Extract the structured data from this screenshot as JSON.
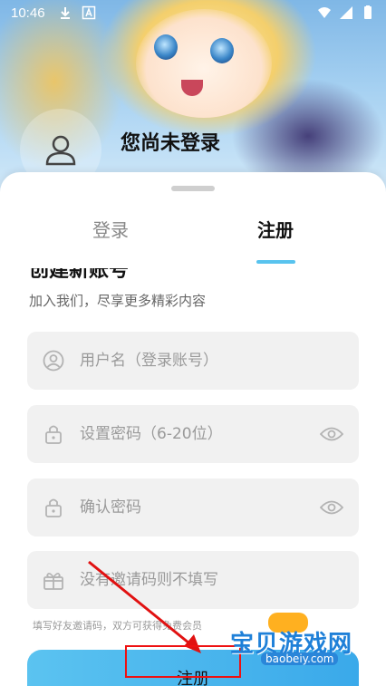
{
  "status_bar": {
    "time": "10:46",
    "icons_left": [
      "download-icon",
      "a-badge-icon"
    ],
    "icons_right": [
      "wifi-icon",
      "signal-icon",
      "battery-icon"
    ]
  },
  "header": {
    "login_status": "您尚未登录"
  },
  "tabs": [
    {
      "label": "登录",
      "active": false
    },
    {
      "label": "注册",
      "active": true
    }
  ],
  "register": {
    "title": "创建新账号",
    "subtitle": "加入我们，尽享更多精彩内容",
    "fields": {
      "username_placeholder": "用户名（登录账号）",
      "password_placeholder": "设置密码（6-20位）",
      "confirm_placeholder": "确认密码",
      "invite_placeholder": "没有邀请码则不填写"
    },
    "hint": "填写好友邀请码，双方可获得免费会员",
    "submit_label": "注册"
  },
  "watermark": {
    "main": "宝贝游戏网",
    "sub": "baobeiy.com"
  },
  "colors": {
    "accent": "#58c3ee",
    "field_bg": "#f1f1f1",
    "annotation": "#e11111"
  }
}
